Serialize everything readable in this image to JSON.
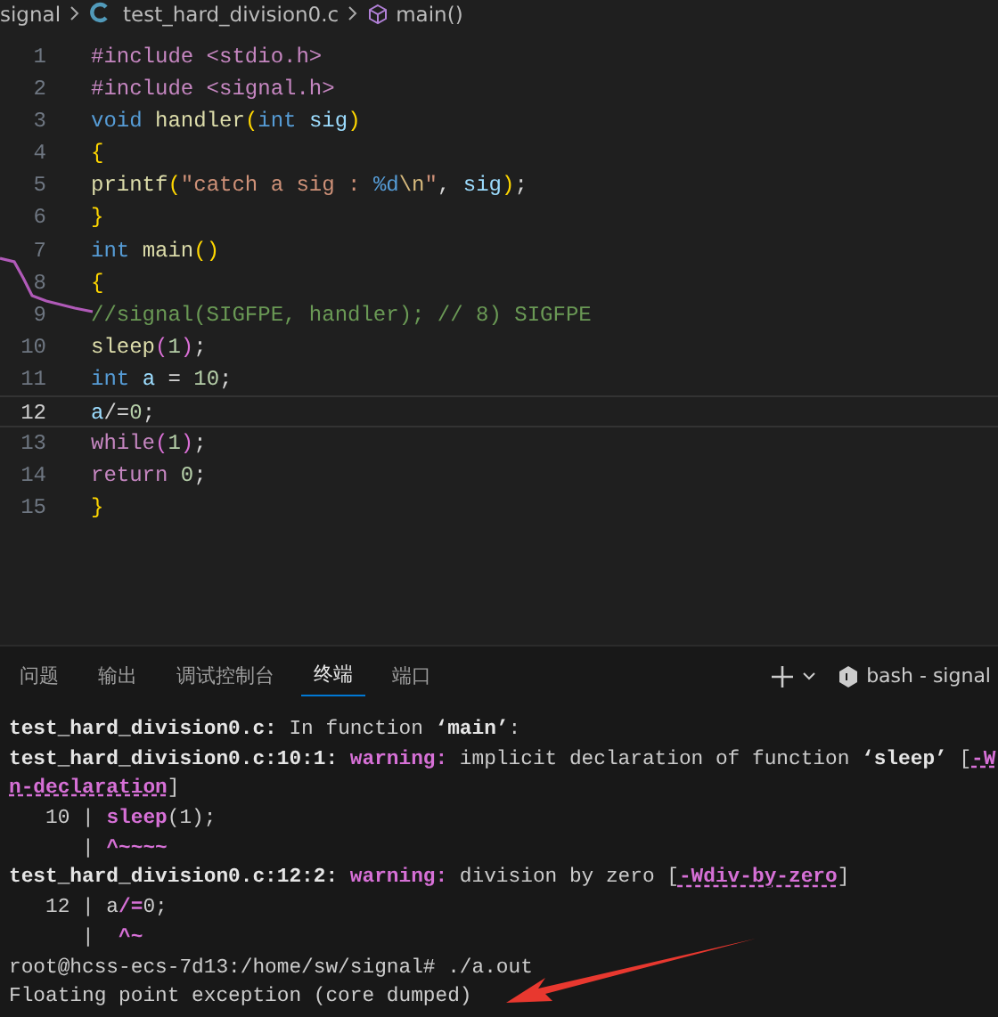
{
  "breadcrumb": [
    {
      "kind": "folder",
      "label": "signal"
    },
    {
      "kind": "c-file",
      "label": "test_hard_division0.c"
    },
    {
      "kind": "function",
      "label": "main()"
    }
  ],
  "editor": {
    "lines": [
      {
        "number": "1",
        "current": false,
        "tokens": [
          {
            "kind": "preproc",
            "text": "#include <stdio.h>"
          }
        ]
      },
      {
        "number": "2",
        "current": false,
        "tokens": [
          {
            "kind": "preproc",
            "text": "#include <signal.h>"
          }
        ]
      },
      {
        "number": "3",
        "current": false,
        "tokens": [
          {
            "kind": "keyword",
            "text": "void "
          },
          {
            "kind": "func",
            "text": "handler"
          },
          {
            "kind": "paren",
            "text": "("
          },
          {
            "kind": "keyword",
            "text": "int "
          },
          {
            "kind": "var",
            "text": "sig"
          },
          {
            "kind": "paren",
            "text": ")"
          }
        ]
      },
      {
        "number": "4",
        "current": false,
        "tokens": [
          {
            "kind": "paren",
            "text": "{"
          }
        ]
      },
      {
        "number": "5",
        "current": false,
        "tokens": [
          {
            "kind": "func",
            "text": "printf"
          },
          {
            "kind": "paren",
            "text": "("
          },
          {
            "kind": "string",
            "text": "\"catch a sig : "
          },
          {
            "kind": "keyword",
            "text": "%d"
          },
          {
            "kind": "escape",
            "text": "\\n"
          },
          {
            "kind": "string",
            "text": "\""
          },
          {
            "kind": "plain",
            "text": ", "
          },
          {
            "kind": "var",
            "text": "sig"
          },
          {
            "kind": "paren",
            "text": ")"
          },
          {
            "kind": "plain",
            "text": ";"
          }
        ]
      },
      {
        "number": "6",
        "current": false,
        "tokens": [
          {
            "kind": "paren",
            "text": "}"
          }
        ]
      },
      {
        "number": "7",
        "current": false,
        "tokens": [
          {
            "kind": "keyword",
            "text": "int "
          },
          {
            "kind": "func",
            "text": "main"
          },
          {
            "kind": "paren",
            "text": "()"
          }
        ]
      },
      {
        "number": "8",
        "current": false,
        "tokens": [
          {
            "kind": "paren",
            "text": "{"
          }
        ]
      },
      {
        "number": "9",
        "current": false,
        "tokens": [
          {
            "kind": "comment",
            "text": "//signal(SIGFPE, handler); // 8) SIGFPE"
          }
        ]
      },
      {
        "number": "10",
        "current": false,
        "tokens": [
          {
            "kind": "func",
            "text": "sleep"
          },
          {
            "kind": "paren2",
            "text": "("
          },
          {
            "kind": "number",
            "text": "1"
          },
          {
            "kind": "paren2",
            "text": ")"
          },
          {
            "kind": "plain",
            "text": ";"
          }
        ]
      },
      {
        "number": "11",
        "current": false,
        "tokens": [
          {
            "kind": "keyword",
            "text": "int "
          },
          {
            "kind": "var",
            "text": "a"
          },
          {
            "kind": "plain",
            "text": " = "
          },
          {
            "kind": "number",
            "text": "10"
          },
          {
            "kind": "plain",
            "text": ";"
          }
        ]
      },
      {
        "number": "12",
        "current": true,
        "tokens": [
          {
            "kind": "var",
            "text": "a"
          },
          {
            "kind": "plain",
            "text": "/="
          },
          {
            "kind": "number",
            "text": "0"
          },
          {
            "kind": "plain",
            "text": ";"
          }
        ]
      },
      {
        "number": "13",
        "current": false,
        "tokens": [
          {
            "kind": "control",
            "text": "while"
          },
          {
            "kind": "paren2",
            "text": "("
          },
          {
            "kind": "number",
            "text": "1"
          },
          {
            "kind": "paren2",
            "text": ")"
          },
          {
            "kind": "plain",
            "text": ";"
          }
        ]
      },
      {
        "number": "14",
        "current": false,
        "tokens": [
          {
            "kind": "control",
            "text": "return "
          },
          {
            "kind": "number",
            "text": "0"
          },
          {
            "kind": "plain",
            "text": ";"
          }
        ]
      },
      {
        "number": "15",
        "current": false,
        "tokens": [
          {
            "kind": "paren",
            "text": "}"
          }
        ]
      }
    ]
  },
  "panel": {
    "tabs": [
      {
        "label": "问题",
        "selected": false
      },
      {
        "label": "输出",
        "selected": false
      },
      {
        "label": "调试控制台",
        "selected": false
      },
      {
        "label": "终端",
        "selected": true
      },
      {
        "label": "端口",
        "selected": false
      }
    ],
    "terminal_name": "bash - signal"
  },
  "terminal": {
    "lines": [
      [
        {
          "kind": "bold",
          "text": "test_hard_division0.c:"
        },
        {
          "kind": "plain",
          "text": " In function "
        },
        {
          "kind": "bold",
          "text": "‘main’"
        },
        {
          "kind": "plain",
          "text": ":"
        }
      ],
      [
        {
          "kind": "bold",
          "text": "test_hard_division0.c:10:1: "
        },
        {
          "kind": "warning",
          "text": "warning:"
        },
        {
          "kind": "plain",
          "text": " implicit declaration of function "
        },
        {
          "kind": "bold",
          "text": "‘sleep’"
        },
        {
          "kind": "plain",
          "text": " ["
        },
        {
          "kind": "flag",
          "text": "-W"
        }
      ],
      [
        {
          "kind": "flag",
          "text": "n-declaration"
        },
        {
          "kind": "plain",
          "text": "]"
        }
      ],
      [
        {
          "kind": "plain",
          "text": "   10 | "
        },
        {
          "kind": "warning",
          "text": "sleep"
        },
        {
          "kind": "plain",
          "text": "(1);"
        }
      ],
      [
        {
          "kind": "plain",
          "text": "      | "
        },
        {
          "kind": "warning",
          "text": "^~~~~"
        }
      ],
      [
        {
          "kind": "bold",
          "text": "test_hard_division0.c:12:2: "
        },
        {
          "kind": "warning",
          "text": "warning:"
        },
        {
          "kind": "plain",
          "text": " division by zero ["
        },
        {
          "kind": "flag",
          "text": "-Wdiv-by-zero"
        },
        {
          "kind": "plain",
          "text": "]"
        }
      ],
      [
        {
          "kind": "plain",
          "text": "   12 | a"
        },
        {
          "kind": "warning",
          "text": "/="
        },
        {
          "kind": "plain",
          "text": "0;"
        }
      ],
      [
        {
          "kind": "plain",
          "text": "      |  "
        },
        {
          "kind": "warning",
          "text": "^~"
        }
      ],
      [
        {
          "kind": "plain",
          "text": "root@hcss-ecs-7d13:/home/sw/signal# ./a.out"
        }
      ],
      [
        {
          "kind": "plain",
          "text": "Floating point exception (core dumped)"
        }
      ]
    ]
  }
}
